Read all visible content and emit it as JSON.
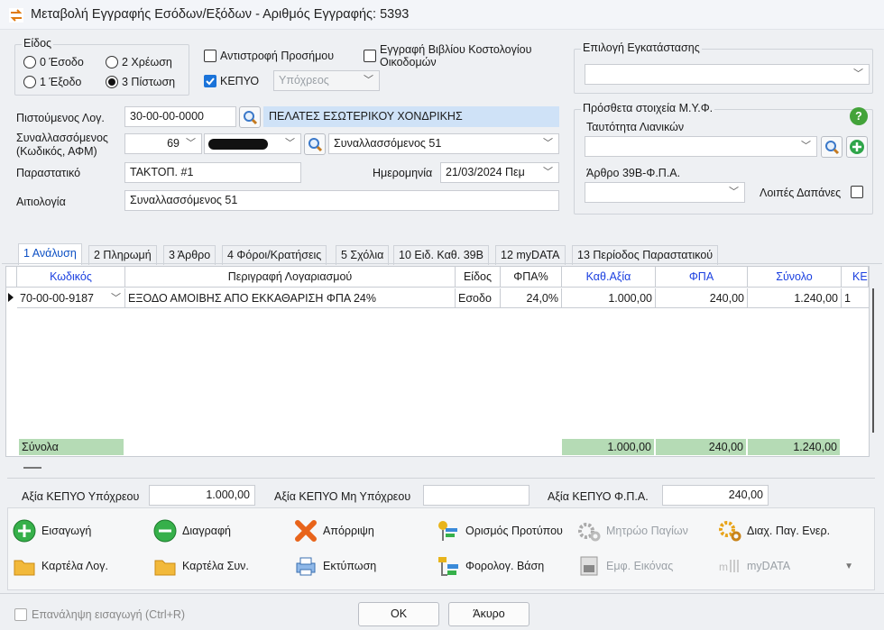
{
  "window": {
    "title": "Μεταβολή Εγγραφής Εσόδων/Εξόδων - Αριθμός Εγγραφής: 5393"
  },
  "kind": {
    "label": "Είδος",
    "options": [
      {
        "label": "0 Έσοδο",
        "selected": false
      },
      {
        "label": "2 Χρέωση",
        "selected": false
      },
      {
        "label": "1 Έξοδο",
        "selected": false
      },
      {
        "label": "3 Πίστωση",
        "selected": true
      }
    ]
  },
  "checks": {
    "reverse_sign": {
      "label": "Αντιστροφή Προσήμου",
      "checked": false
    },
    "cost_book": {
      "label": "Εγγραφή Βιβλίου Κοστολογίου Οικοδομών",
      "checked": false
    },
    "kepyo": {
      "label": "ΚΕΠΥΟ",
      "checked": true
    },
    "obligation": {
      "value": "Υπόχρεος"
    }
  },
  "install": {
    "label": "Επιλογή Εγκατάστασης",
    "value": ""
  },
  "myf": {
    "label": "Πρόσθετα στοιχεία Μ.Υ.Φ.",
    "retail_id_label": "Ταυτότητα Λιανικών",
    "retail_id_value": "",
    "art39_label": "Άρθρο 39Β-Φ.Π.Α.",
    "art39_value": "",
    "other_expenses_label": "Λοιπές Δαπάνες",
    "other_expenses_checked": false
  },
  "form": {
    "credited_label": "Πιστούμενος Λογ.",
    "credited_code": "30-00-00-0000",
    "credited_name": "ΠΕΛΑΤΕΣ ΕΣΩΤΕΡΙΚΟΥ ΧΟΝΔΡΙΚΗΣ",
    "partner_label": "Συναλλασσόμενος\n(Κωδικός, ΑΦΜ)",
    "partner_code": "69",
    "partner_name": "Συναλλασσόμενος 51",
    "doc_label": "Παραστατικό",
    "doc_value": "ΤΑΚΤΟΠ. #1",
    "date_label": "Ημερομηνία",
    "date_value": "21/03/2024 Πεμ",
    "reason_label": "Αιτιολογία",
    "reason_value": "Συναλλασσόμενος 51"
  },
  "tabs": [
    "1 Ανάλυση",
    "2 Πληρωμή",
    "3 Άρθρο",
    "4 Φόροι/Κρατήσεις",
    "5 Σχόλια",
    "10 Ειδ. Καθ. 39Β",
    "12 myDATA",
    "13 Περίοδος Παραστατικού"
  ],
  "grid": {
    "headers": [
      "Κωδικός",
      "Περιγραφή Λογαριασμού",
      "Είδος",
      "ΦΠΑ%",
      "Καθ.Αξία",
      "ΦΠΑ",
      "Σύνολο",
      "ΚΕ"
    ],
    "rows": [
      {
        "code": "70-00-00-9187",
        "desc": "ΕΞΟΔΟ ΑΜΟΙΒΗΣ ΑΠΟ ΕΚΚΑΘΑΡΙΣΗ ΦΠΑ 24%",
        "kind": "Εσοδο",
        "vat_pct": "24,0%",
        "net": "1.000,00",
        "vat": "240,00",
        "total": "1.240,00",
        "ke": "1"
      }
    ],
    "totals": {
      "label": "Σύνολα",
      "net": "1.000,00",
      "vat": "240,00",
      "total": "1.240,00"
    }
  },
  "bottom": {
    "kepyo_obl_label": "Αξία ΚΕΠΥΟ Υπόχρεου",
    "kepyo_obl_value": "1.000,00",
    "kepyo_nonobl_label": "Αξία ΚΕΠΥΟ Μη Υπόχρεου",
    "kepyo_nonobl_value": "",
    "kepyo_vat_label": "Αξία ΚΕΠΥΟ Φ.Π.Α.",
    "kepyo_vat_value": "240,00"
  },
  "actions": {
    "insert": "Εισαγωγή",
    "delete": "Διαγραφή",
    "discard": "Απόρριψη",
    "template": "Ορισμός Προτύπου",
    "assets": "Μητρώο Παγίων",
    "asset_mgmt": "Διαχ. Παγ. Ενερ.",
    "acc_card": "Καρτέλα Λογ.",
    "partner_card": "Καρτέλα Συν.",
    "print": "Εκτύπωση",
    "tax_base": "Φορολογ. Βάση",
    "img_view": "Εμφ. Εικόνας",
    "mydata": "myDATA"
  },
  "footer": {
    "repeat_label": "Επανάληψη εισαγωγή (Ctrl+R)",
    "ok": "ΟΚ",
    "cancel": "Άκυρο"
  },
  "colors": {
    "accent": "#1a73d9",
    "highlight": "#cfe2f7",
    "totals": "#b5dbb5"
  }
}
